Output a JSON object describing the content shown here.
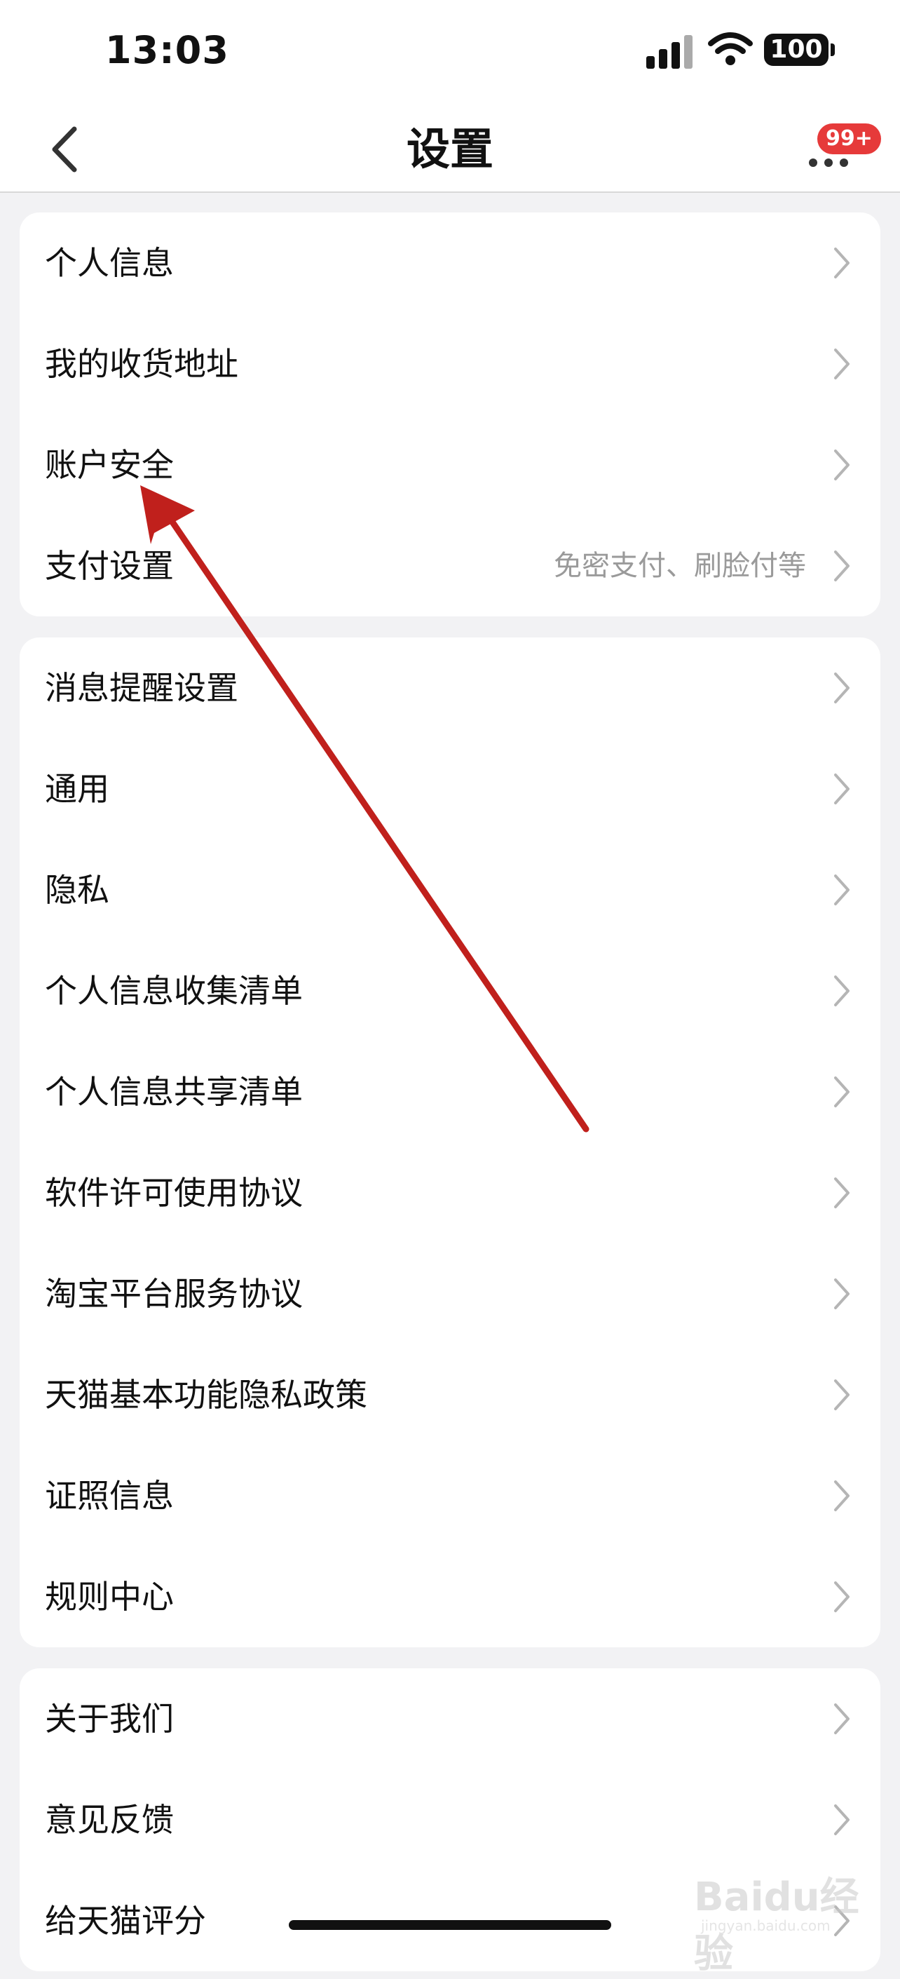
{
  "status_bar": {
    "time": "13:03",
    "battery": "100"
  },
  "nav": {
    "title": "设置",
    "badge": "99+"
  },
  "groups": [
    {
      "items": [
        {
          "label": "个人信息",
          "sub": ""
        },
        {
          "label": "我的收货地址",
          "sub": ""
        },
        {
          "label": "账户安全",
          "sub": ""
        },
        {
          "label": "支付设置",
          "sub": "免密支付、刷脸付等"
        }
      ]
    },
    {
      "items": [
        {
          "label": "消息提醒设置"
        },
        {
          "label": "通用"
        },
        {
          "label": "隐私"
        },
        {
          "label": "个人信息收集清单"
        },
        {
          "label": "个人信息共享清单"
        },
        {
          "label": "软件许可使用协议"
        },
        {
          "label": "淘宝平台服务协议"
        },
        {
          "label": "天猫基本功能隐私政策"
        },
        {
          "label": "证照信息"
        },
        {
          "label": "规则中心"
        }
      ]
    },
    {
      "items": [
        {
          "label": "关于我们"
        },
        {
          "label": "意见反馈"
        },
        {
          "label": "给天猫评分"
        }
      ]
    }
  ],
  "watermark": {
    "text": "Baidu经验",
    "url_text": "jingyan.baidu.com"
  },
  "annotation_arrow": {
    "color": "#c0201c"
  }
}
